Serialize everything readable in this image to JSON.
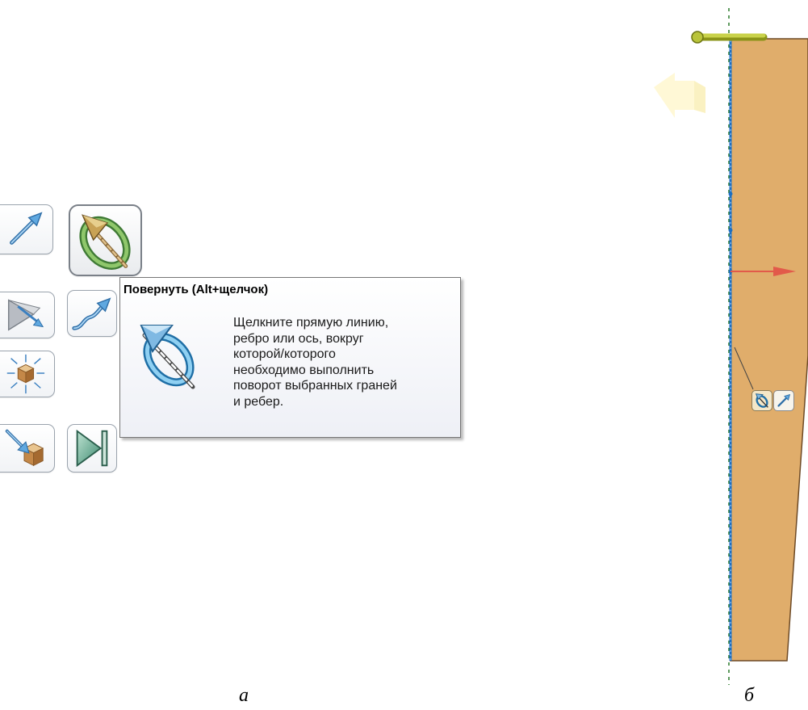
{
  "toolbar": {
    "buttons": [
      {
        "name": "move-arrow-button",
        "icon": "move-arrow-icon"
      },
      {
        "name": "rotate-button",
        "icon": "rotate-axis-icon",
        "active": true
      },
      {
        "name": "move-faces-button",
        "icon": "move-faces-icon"
      },
      {
        "name": "path-move-button",
        "icon": "path-arrow-icon"
      },
      {
        "name": "scale-explode-button",
        "icon": "explode-cube-icon"
      },
      {
        "name": "pull-to-face-button",
        "icon": "pull-to-face-icon"
      },
      {
        "name": "up-to-button",
        "icon": "up-to-play-icon"
      }
    ]
  },
  "tooltip": {
    "title": "Повернуть (Alt+щелчок)",
    "icon": "rotate-axis-icon",
    "lines": [
      "Щелкните прямую линию,",
      "ребро или ось, вокруг",
      "которой/которого",
      "необходимо выполнить",
      "поворот выбранных граней",
      "и ребер."
    ]
  },
  "captions": {
    "a": "а",
    "b": "б"
  },
  "viewport": {
    "part_color": "#e0ad6b",
    "axis_color": "#1f6fc0",
    "handle_color": "#b9c43a",
    "arrow_color": "#e25a4a",
    "mini_tools": [
      {
        "name": "rotate-mini-button",
        "icon": "rotate-mini-icon"
      },
      {
        "name": "move-mini-button",
        "icon": "move-mini-icon"
      }
    ]
  }
}
